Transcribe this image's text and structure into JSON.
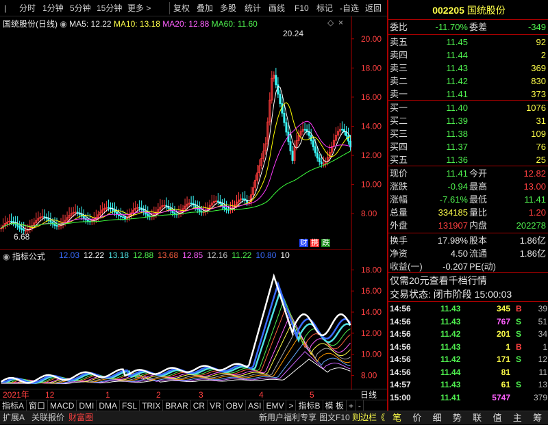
{
  "toolbar": {
    "items": [
      "分时",
      "1分钟",
      "5分钟",
      "15分钟",
      "更多 >",
      "复权",
      "叠加",
      "多股",
      "统计",
      "画线",
      "F10",
      "标记",
      "-自选",
      "返回"
    ]
  },
  "chart": {
    "title": "国统股份(日线)",
    "ma5": "MA5: 12.22",
    "ma10": "MA10: 13.18",
    "ma20": "MA20: 12.88",
    "ma60": "MA60: 11.60",
    "high_label": "20.24",
    "low_label": "6.68",
    "badges": [
      "财",
      "携",
      "跌"
    ],
    "y_ticks": [
      "20.00",
      "18.00",
      "16.00",
      "14.00",
      "12.00",
      "10.00",
      "8.00"
    ],
    "colors": {
      "ma5": "#ffffff",
      "ma10": "#ffff00",
      "ma20": "#ff3cff",
      "ma60": "#3cff3c",
      "up": "#ff3c3c",
      "down": "#3cffff",
      "grid": "#600000"
    }
  },
  "indicator": {
    "title": "指标公式",
    "values": [
      "12.03",
      "12.22",
      "13.18",
      "12.88",
      "13.68",
      "12.85",
      "12.16",
      "11.22",
      "10.80",
      "10"
    ],
    "value_colors": [
      "#3a6cff",
      "#ffffff",
      "#4fe0e0",
      "#4ff14f",
      "#ff6040",
      "#ff60ff",
      "#c8c8c8",
      "#4ff14f",
      "#3a6cff",
      "#ffffff"
    ],
    "y_ticks": [
      "18.00",
      "16.00",
      "14.00",
      "12.00",
      "10.00",
      "8.00"
    ]
  },
  "timeaxis": {
    "labels": [
      "2021年",
      "12",
      "1",
      "2",
      "3",
      "4",
      "5"
    ],
    "period": "日线"
  },
  "tabs_row": {
    "items": [
      "指标A",
      "窗口",
      "MACD",
      "DMI",
      "DMA",
      "FSL",
      "TRIX",
      "BRAR",
      "CR",
      "VR",
      "OBV",
      "ASI",
      "EMV",
      ">",
      "指标B",
      "模 板",
      "+",
      "-"
    ]
  },
  "bottom_row": {
    "left": [
      "扩展A",
      "关联报价",
      "财富圈"
    ],
    "right": [
      "新用户福利专享",
      "图文F10",
      "则边栏《"
    ],
    "tabs": [
      "笔",
      "价",
      "细",
      "势",
      "联",
      "值",
      "主",
      "筹"
    ]
  },
  "stock": {
    "code": "002205",
    "name": "国统股份"
  },
  "orderbook": {
    "weibi_label": "委比",
    "weibi": "-11.70%",
    "weicha_label": "委差",
    "weicha": "-349",
    "asks": [
      {
        "label": "卖五",
        "price": "11.45",
        "vol": "92"
      },
      {
        "label": "卖四",
        "price": "11.44",
        "vol": "2"
      },
      {
        "label": "卖三",
        "price": "11.43",
        "vol": "369"
      },
      {
        "label": "卖二",
        "price": "11.42",
        "vol": "830"
      },
      {
        "label": "卖一",
        "price": "11.41",
        "vol": "373"
      }
    ],
    "bids": [
      {
        "label": "买一",
        "price": "11.40",
        "vol": "1076"
      },
      {
        "label": "买二",
        "price": "11.39",
        "vol": "31"
      },
      {
        "label": "买三",
        "price": "11.38",
        "vol": "109"
      },
      {
        "label": "买四",
        "price": "11.37",
        "vol": "76"
      },
      {
        "label": "买五",
        "price": "11.36",
        "vol": "25"
      }
    ]
  },
  "quote": {
    "rows": [
      {
        "l1": "现价",
        "v1": "11.41",
        "l2": "今开",
        "v2": "12.82",
        "c1": "g",
        "c2": "r"
      },
      {
        "l1": "涨跌",
        "v1": "-0.94",
        "l2": "最高",
        "v2": "13.00",
        "c1": "g",
        "c2": "r"
      },
      {
        "l1": "涨幅",
        "v1": "-7.61%",
        "l2": "最低",
        "v2": "11.41",
        "c1": "g",
        "c2": "g"
      },
      {
        "l1": "总量",
        "v1": "334185",
        "l2": "量比",
        "v2": "1.20",
        "c1": "y",
        "c2": "r"
      },
      {
        "l1": "外盘",
        "v1": "131907",
        "l2": "内盘",
        "v2": "202278",
        "c1": "r",
        "c2": "g"
      }
    ],
    "rows2": [
      {
        "l1": "换手",
        "v1": "17.98%",
        "l2": "股本",
        "v2": "1.86亿"
      },
      {
        "l1": "净资",
        "v1": "4.50",
        "l2": "流通",
        "v2": "1.86亿"
      },
      {
        "l1": "收益(一)",
        "v1": "-0.207",
        "l2": "PE(动)",
        "v2": ""
      }
    ],
    "promo": "仅需20元查看千档行情",
    "status": "交易状态: 闭市阶段 15:00:03"
  },
  "ticks": [
    {
      "t": "14:56",
      "p": "11.43",
      "v": "345",
      "s": "B",
      "n": "39",
      "vc": "y",
      "sc": "r"
    },
    {
      "t": "14:56",
      "p": "11.43",
      "v": "767",
      "s": "S",
      "n": "51",
      "vc": "m",
      "sc": "g"
    },
    {
      "t": "14:56",
      "p": "11.42",
      "v": "201",
      "s": "S",
      "n": "34",
      "vc": "y",
      "sc": "g"
    },
    {
      "t": "14:56",
      "p": "11.43",
      "v": "1",
      "s": "B",
      "n": "1",
      "vc": "y",
      "sc": "r"
    },
    {
      "t": "14:56",
      "p": "11.42",
      "v": "171",
      "s": "S",
      "n": "12",
      "vc": "y",
      "sc": "g"
    },
    {
      "t": "14:56",
      "p": "11.44",
      "v": "81",
      "s": "",
      "n": "11",
      "vc": "y",
      "sc": "g"
    },
    {
      "t": "14:57",
      "p": "11.43",
      "v": "61",
      "s": "S",
      "n": "13",
      "vc": "y",
      "sc": "g"
    },
    {
      "t": "15:00",
      "p": "11.41",
      "v": "5747",
      "s": "",
      "n": "379",
      "vc": "m",
      "sc": "g"
    }
  ]
}
